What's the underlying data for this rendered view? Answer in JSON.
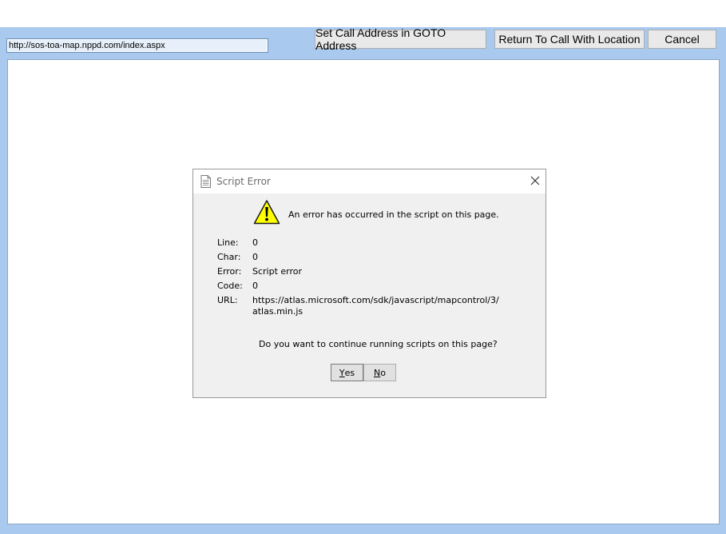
{
  "toolbar": {
    "url": "http://sos-toa-map.nppd.com/index.aspx",
    "set_call_address_label": "Set Call Address in GOTO Address",
    "return_to_call_label": "Return To Call With Location",
    "cancel_label": "Cancel"
  },
  "dialog": {
    "title": "Script Error",
    "message": "An error has occurred in the script on this page.",
    "fields": {
      "line_label": "Line:",
      "line_value": "0",
      "char_label": "Char:",
      "char_value": "0",
      "error_label": "Error:",
      "error_value": "Script error",
      "code_label": "Code:",
      "code_value": "0",
      "url_label": "URL:",
      "url_value": "https://atlas.microsoft.com/sdk/javascript/mapcontrol/3/atlas.min.js"
    },
    "question": "Do you want to continue running scripts on this page?",
    "yes_label_first": "Y",
    "yes_label_rest": "es",
    "no_label_first": "N",
    "no_label_rest": "o"
  },
  "icons": {
    "page": "document-icon",
    "close": "close-icon",
    "warning": "warning-icon"
  },
  "colors": {
    "toolbar_bg": "#a9c9ee",
    "warning_yellow": "#ffff00"
  }
}
